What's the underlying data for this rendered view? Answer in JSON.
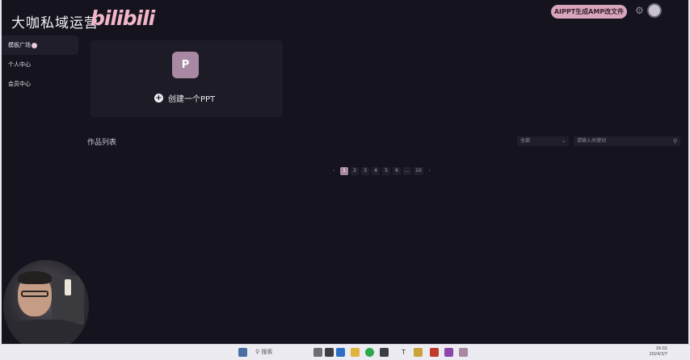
{
  "header": {
    "brand": "大咖私域运营",
    "logo_text": "bilibili",
    "pill_text": "AIPPT生成AMP改文件",
    "settings_icon": "gear-icon",
    "avatar_icon": "avatar-icon"
  },
  "sidebar": {
    "items": [
      {
        "label": "模板广场",
        "active": true
      },
      {
        "label": "个人中心",
        "active": false
      },
      {
        "label": "会员中心",
        "active": false
      }
    ]
  },
  "create_card": {
    "icon_letter": "P",
    "label": "创建一个PPT"
  },
  "works": {
    "title": "作品列表",
    "filter_value": "全部",
    "search_placeholder": "请输入关键词"
  },
  "pagination": {
    "prev": "‹",
    "pages": [
      "1",
      "2",
      "3",
      "4",
      "5",
      "6",
      "…",
      "10"
    ],
    "current": "1",
    "next": "›"
  },
  "taskbar": {
    "search_label": "搜索",
    "time": "16:02",
    "date": "2024/3/7"
  },
  "colors": {
    "background": "#15141e",
    "accent": "#a888a2",
    "logo_pink": "#f3b6c9",
    "pill": "#d7a6bd"
  }
}
